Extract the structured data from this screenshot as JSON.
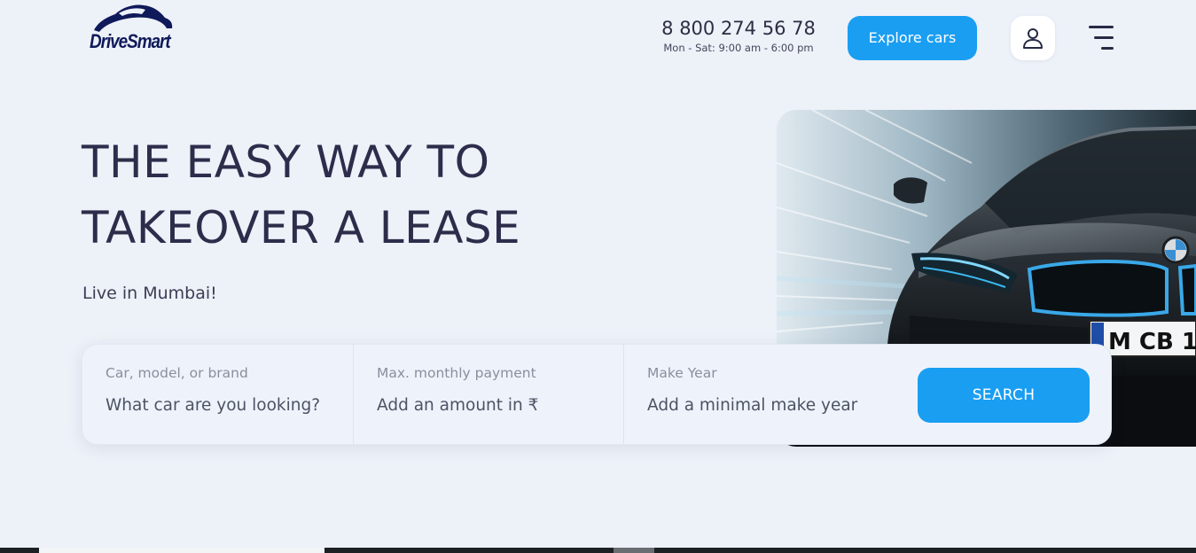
{
  "header": {
    "logo": {
      "text": "DriveSmart"
    },
    "contact": {
      "phone": "8 800 274 56 78",
      "hours": "Mon - Sat: 9:00 am - 6:00 pm"
    },
    "explore_label": "Explore cars",
    "user_icon": "user-icon",
    "menu_icon": "menu-icon"
  },
  "hero": {
    "title_line1": "THE EASY WAY TO",
    "title_line2": "TAKEOVER A LEASE",
    "subtitle": "Live in Mumbai!"
  },
  "search": {
    "fields": [
      {
        "label": "Car, model, or brand",
        "placeholder": "What car are you looking?",
        "value": ""
      },
      {
        "label": "Max. monthly payment",
        "placeholder": "Add an amount in ₹",
        "value": ""
      },
      {
        "label": "Make Year",
        "placeholder": "Add a minimal make year",
        "value": ""
      }
    ],
    "button_label": "SEARCH"
  },
  "hero_image": {
    "plate_text": "M CB 1"
  },
  "colors": {
    "background": "#edf1f8",
    "accent": "#1a9ef2",
    "heading": "#2d2d4b",
    "logo": "#0f1a5a"
  }
}
